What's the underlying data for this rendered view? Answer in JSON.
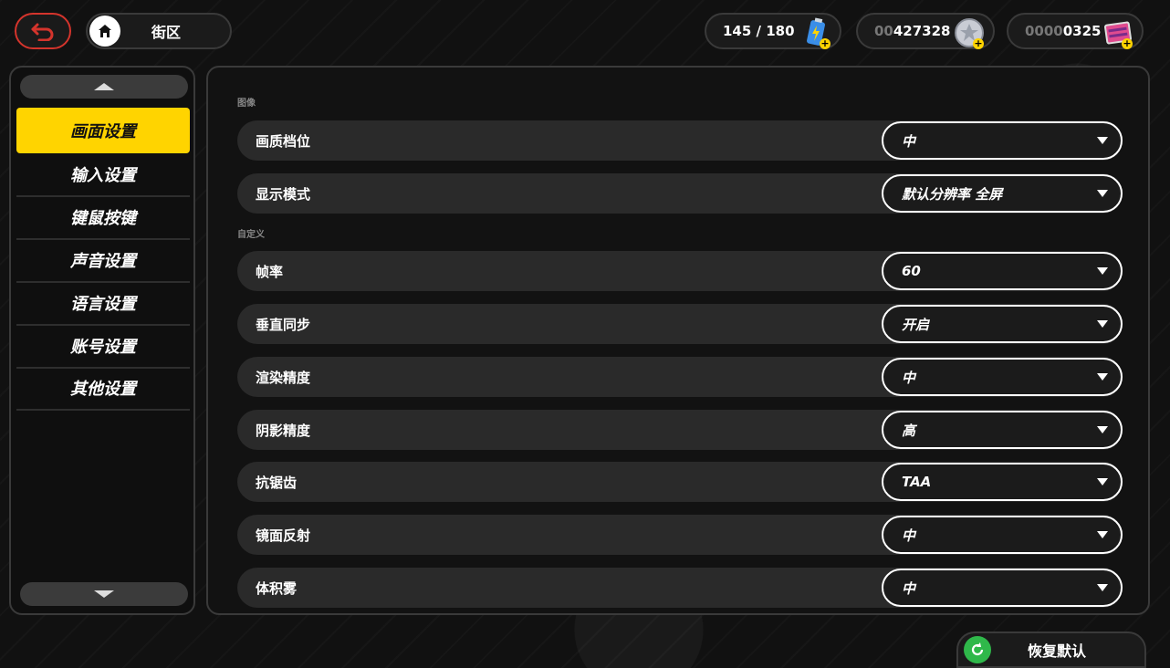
{
  "header": {
    "location_label": "街区",
    "currencies": [
      {
        "name": "battery-charge",
        "dim": "",
        "value": "145 / 180"
      },
      {
        "name": "dennies",
        "dim": "00",
        "value": "427328"
      },
      {
        "name": "film",
        "dim": "0000",
        "value": "0325"
      }
    ]
  },
  "sidebar": {
    "items": [
      {
        "label": "画面设置"
      },
      {
        "label": "输入设置"
      },
      {
        "label": "键鼠按键"
      },
      {
        "label": "声音设置"
      },
      {
        "label": "语言设置"
      },
      {
        "label": "账号设置"
      },
      {
        "label": "其他设置"
      }
    ]
  },
  "main": {
    "section_image": "图像",
    "section_custom": "自定义",
    "rows": [
      {
        "label": "画质档位",
        "value": "中"
      },
      {
        "label": "显示模式",
        "value": "默认分辨率 全屏"
      },
      {
        "label": "帧率",
        "value": "60"
      },
      {
        "label": "垂直同步",
        "value": "开启"
      },
      {
        "label": "渲染精度",
        "value": "中"
      },
      {
        "label": "阴影精度",
        "value": "高"
      },
      {
        "label": "抗锯齿",
        "value": "TAA"
      },
      {
        "label": "镜面反射",
        "value": "中"
      },
      {
        "label": "体积雾",
        "value": "中"
      }
    ]
  },
  "footer": {
    "restore_label": "恢复默认"
  },
  "colors": {
    "accent": "#ffd400",
    "back_border": "#d4342c",
    "restore_icon": "#2fb84a"
  }
}
